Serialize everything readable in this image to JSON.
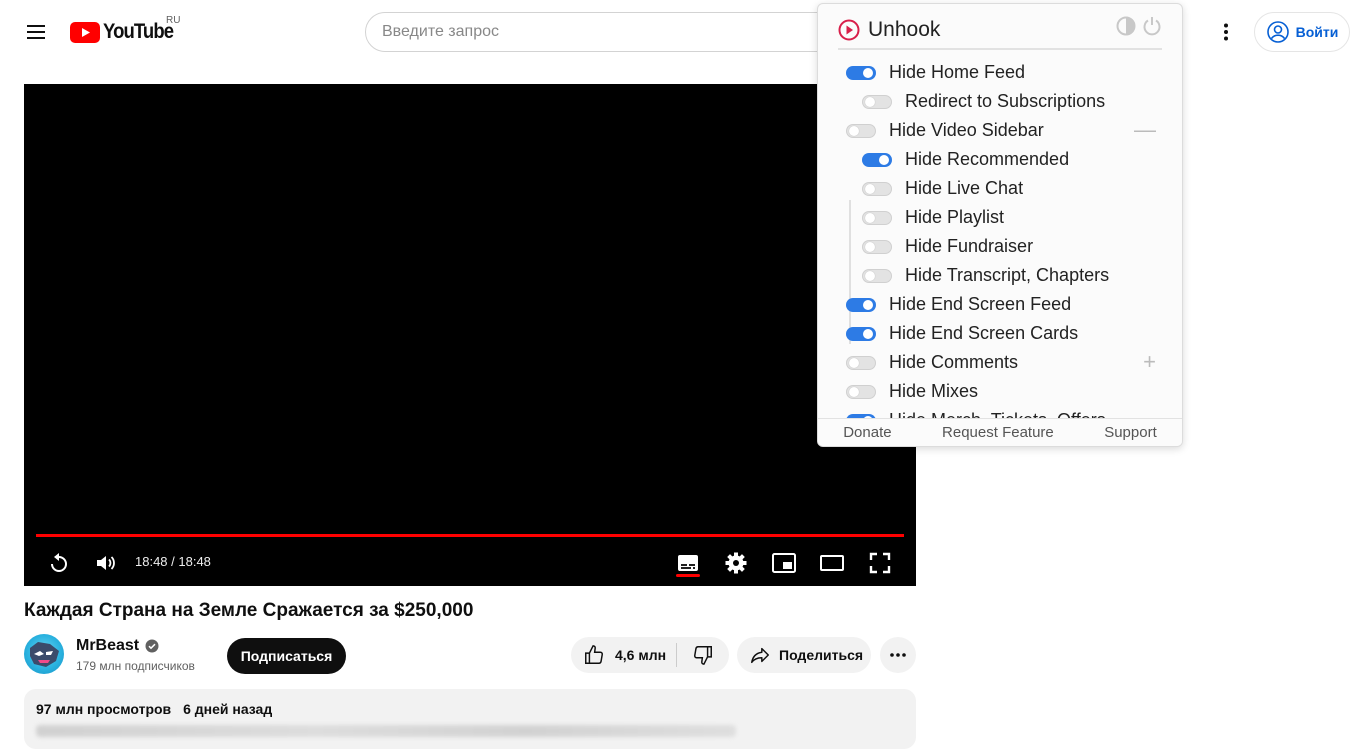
{
  "header": {
    "menu_icon": "hamburger-menu-icon",
    "logo_text": "YouTube",
    "logo_region": "RU",
    "search_placeholder": "Введите запрос",
    "more_icon": "vertical-dots-icon",
    "signin_label": "Войти",
    "colors": {
      "brand_red": "#ff0000",
      "link_blue": "#065fd4"
    }
  },
  "player": {
    "time": "18:48 / 18:48",
    "progress_fraction": 1.0,
    "controls": [
      "replay-icon",
      "volume-icon",
      "subtitles-icon",
      "settings-gear-icon",
      "miniplayer-icon",
      "theater-mode-icon",
      "fullscreen-icon"
    ]
  },
  "video": {
    "title": "Каждая Страна на Земле Сражается за $250,000",
    "channel_name": "MrBeast",
    "subscribers": "179 млн подписчиков",
    "subscribe_label": "Подписаться",
    "likes": "4,6 млн",
    "share_label": "Поделиться",
    "views": "97 млн просмотров",
    "uploaded": "6 дней назад"
  },
  "unhook": {
    "title": "Unhook",
    "options": [
      {
        "label": "Hide Home Feed",
        "on": true,
        "level": 0
      },
      {
        "label": "Redirect to Subscriptions",
        "on": false,
        "level": 1
      },
      {
        "label": "Hide Video Sidebar",
        "on": false,
        "level": 0,
        "expander": "—"
      },
      {
        "label": "Hide Recommended",
        "on": true,
        "level": 1
      },
      {
        "label": "Hide Live Chat",
        "on": false,
        "level": 1
      },
      {
        "label": "Hide Playlist",
        "on": false,
        "level": 1
      },
      {
        "label": "Hide Fundraiser",
        "on": false,
        "level": 1
      },
      {
        "label": "Hide Transcript, Chapters",
        "on": false,
        "level": 1
      },
      {
        "label": "Hide End Screen Feed",
        "on": true,
        "level": 0
      },
      {
        "label": "Hide End Screen Cards",
        "on": true,
        "level": 0
      },
      {
        "label": "Hide Comments",
        "on": false,
        "level": 0,
        "expander": "+"
      },
      {
        "label": "Hide Mixes",
        "on": false,
        "level": 0
      },
      {
        "label": "Hide Merch, Tickets, Offers",
        "on": true,
        "level": 0
      }
    ],
    "footer": {
      "donate": "Donate",
      "request": "Request Feature",
      "support": "Support"
    },
    "colors": {
      "toggle_on": "#2d7be5",
      "logo_red": "#d81f4a"
    }
  }
}
